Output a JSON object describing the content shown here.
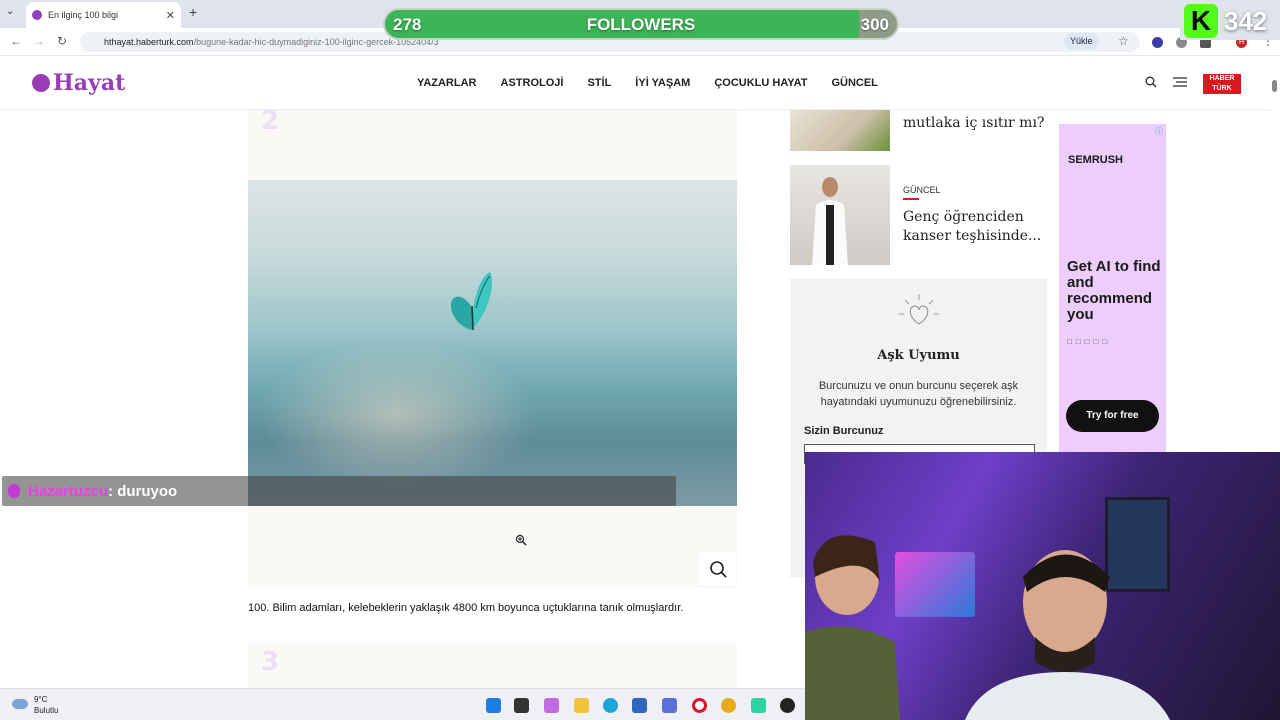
{
  "browser": {
    "tab_title": "En ilginç 100 bilgi",
    "tab_close": "✕",
    "new_tab": "+",
    "tab_list": "⌄",
    "url_host": "hthayat.haberturk.com",
    "url_path": "/bugune-kadar-hic-duymadiginiz-100-ilginc-gercek-1052404/3",
    "install_label": "Yükle",
    "profile_initial": "H"
  },
  "overlay": {
    "followers_current": "278",
    "followers_label": "FOLLOWERS",
    "followers_goal": "300",
    "followers_progress": 0.0,
    "kick_letter": "K",
    "kick_count": "342"
  },
  "site": {
    "logo": "Hayat",
    "menu": [
      "YAZARLAR",
      "ASTROLOJİ",
      "STİL",
      "İYİ YAŞAM",
      "ÇOCUKLU HAYAT",
      "GÜNCEL"
    ],
    "brand_badge_line1": "HABER",
    "brand_badge_line2": "TÜRK"
  },
  "article": {
    "number_top": "2",
    "number_bottom": "3",
    "fact": "100. Bilim adamları, kelebeklerin yaklaşık 4800 km boyunca uçtuklarına tanık olmuşlardır."
  },
  "chat": {
    "user": "Hazartuzcu",
    "message": " : duruyoo"
  },
  "sidebar": {
    "item1_title": "mutlaka iç ısıtır mı?",
    "item2_category": "GÜNCEL",
    "item2_title_line1": "Genç öğrenciden",
    "item2_title_line2": "kanser teşhisinde..."
  },
  "love": {
    "title": "Aşk Uyumu",
    "desc": "Burcunuzu ve onun burcunu seçerek aşk hayatındaki uyumunuzu öğrenebilirsiniz.",
    "label": "Sizin Burcunuz"
  },
  "ad": {
    "brand": "SEMRUSH",
    "headline": "Get AI to find and recommend you",
    "cta": "Try for free"
  },
  "taskbar": {
    "temp": "9°C",
    "condition": "Bulutlu"
  },
  "colors": {
    "brand": "#9b3cb7",
    "accent_red": "#d71920",
    "followers_fill": "#3cb557",
    "kick_green": "#53fc18"
  }
}
